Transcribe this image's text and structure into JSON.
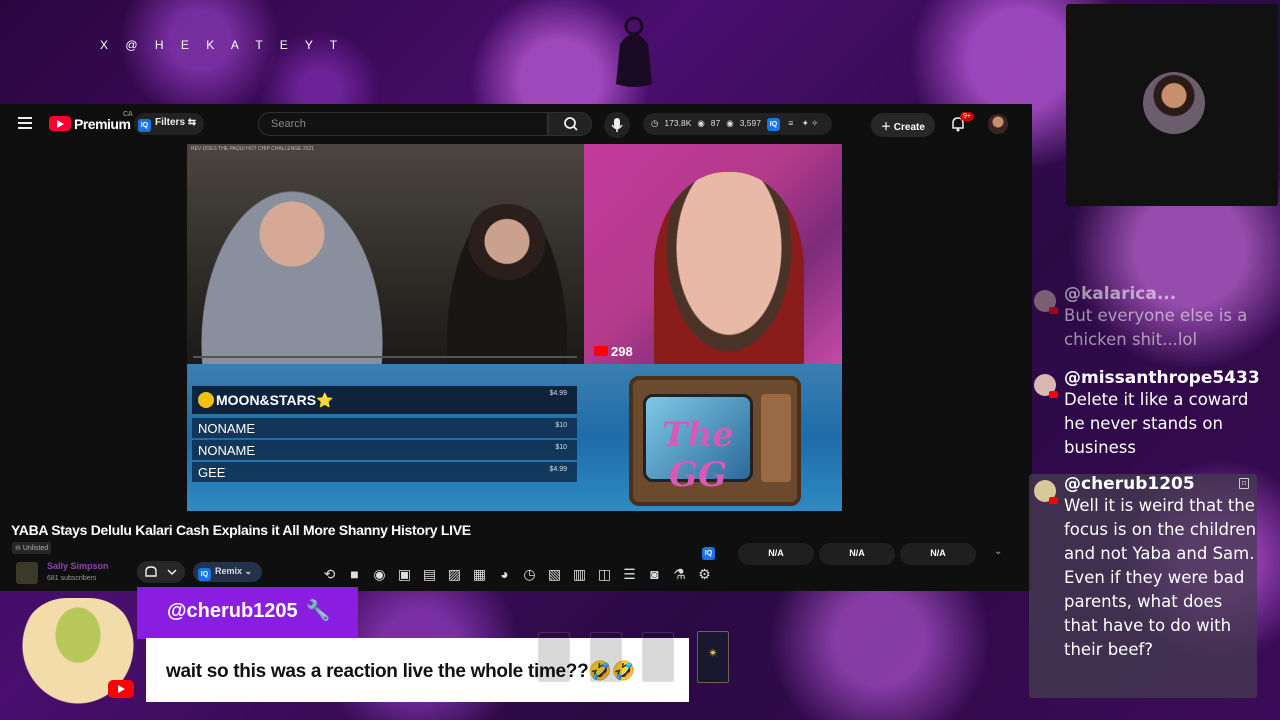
{
  "brand": {
    "handle": "X @ H E K A T E Y T"
  },
  "youtube": {
    "logo_text": "Premium",
    "region": "CA",
    "filters_label": "Filters",
    "search_placeholder": "Search",
    "stats": {
      "subs": "173.8K",
      "value2": "87",
      "value3": "3,597"
    },
    "create_label": "Create",
    "notif_badge": "9+"
  },
  "video": {
    "caption": "REV DOES THE PAQUI HOT CHIP CHALLENGE 2021",
    "viewer_count": "298",
    "donations": [
      {
        "name": "MOON&STARS",
        "amount": "$4.99"
      },
      {
        "name": "NONAME",
        "amount": "$10"
      },
      {
        "name": "NONAME",
        "amount": "$10"
      },
      {
        "name": "GEE",
        "amount": "$4.99"
      }
    ],
    "tv_logo": "The GG"
  },
  "watch": {
    "title": "YABA Stays Delulu Kalari Cash Explains it All More Shanny History LIVE",
    "visibility": "Unlisted",
    "channel_name": "Sally Simpson",
    "channel_subs": "681 subscribers",
    "remix_label": "Remix",
    "na_values": [
      "N/A",
      "N/A",
      "N/A"
    ]
  },
  "chat": {
    "messages": [
      {
        "user": "@kalarica...",
        "text": "But everyone else is a chicken shit...lol"
      },
      {
        "user": "@missanthrope5433",
        "text": "Delete it like a coward he never stands on business"
      },
      {
        "user": "@cherub1205",
        "text": "Well it is weird that the focus is on the children and not Yaba and Sam. Even if they were bad parents, what does that have to do with their beef?"
      }
    ]
  },
  "alert": {
    "username": "@cherub1205",
    "message": "wait so this was a reaction live the whole time??🤣🤣"
  },
  "colors": {
    "accent_purple": "#8a1ee0",
    "youtube_red": "#ff0000",
    "overlay_blue": "#1f6ca8"
  }
}
